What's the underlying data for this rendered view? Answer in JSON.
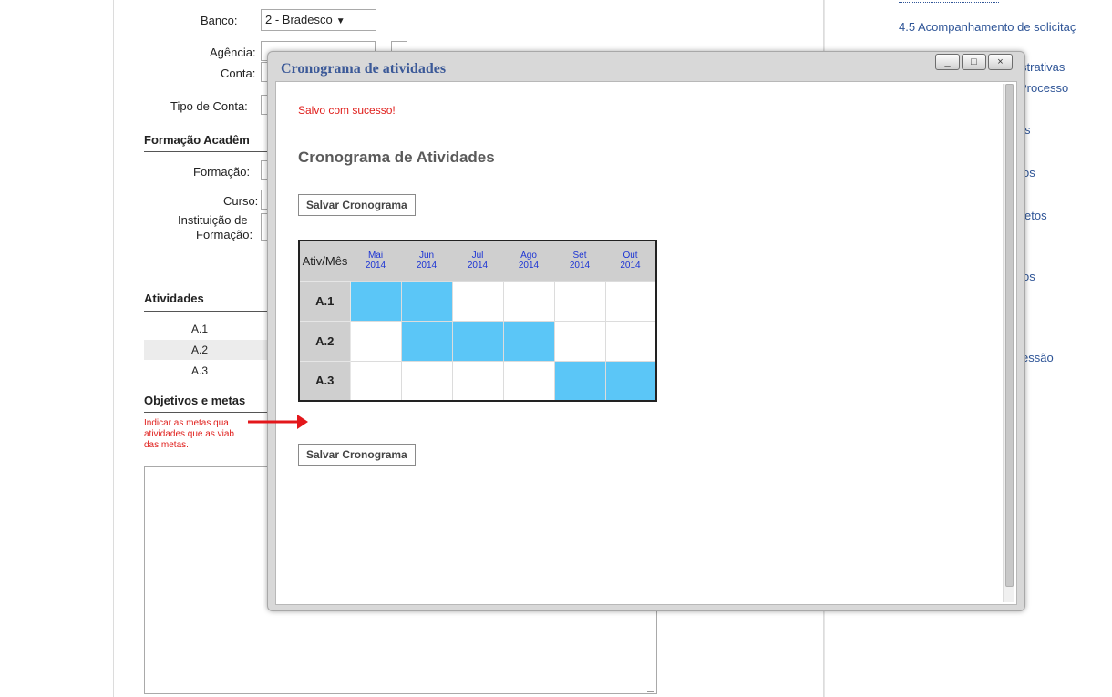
{
  "background": {
    "bank": {
      "label": "Banco:",
      "value": "2 - Bradesco"
    },
    "agency_label": "Agência:",
    "account_label": "Conta:",
    "account_type_label": "Tipo de Conta:",
    "academic_section": "Formação Acadêm",
    "formation_label": "Formação:",
    "course_label": "Curso:",
    "institution_label_1": "Instituição de",
    "institution_label_2": "Formação:",
    "activities_section": "Atividades",
    "activities": [
      "A.1",
      "A.2",
      "A.3"
    ],
    "objectives_section": "Objetivos e metas",
    "objectives_note_lines": [
      "Indicar as metas qua",
      "atividades que as viab",
      "das metas."
    ]
  },
  "right_sidebar": {
    "links": [
      {
        "text": "4.5 Acompanhamento de solicitaç"
      },
      {
        "text": "strativas"
      },
      {
        "text": "Processo"
      },
      {
        "text": "s"
      },
      {
        "text": "os"
      },
      {
        "text": "etos"
      },
      {
        "text": "os"
      },
      {
        "text": "essão"
      }
    ]
  },
  "modal": {
    "title": "Cronograma de atividades",
    "controls": {
      "minimize": "_",
      "maximize": "□",
      "close": "×"
    },
    "success_message": "Salvo com sucesso!",
    "heading": "Cronograma de Atividades",
    "save_button_top": "Salvar Cronograma",
    "save_button_bottom": "Salvar Cronograma",
    "schedule": {
      "corner_label": "Ativ/Mês",
      "months": [
        {
          "name": "Mai",
          "year": "2014"
        },
        {
          "name": "Jun",
          "year": "2014"
        },
        {
          "name": "Jul",
          "year": "2014"
        },
        {
          "name": "Ago",
          "year": "2014"
        },
        {
          "name": "Set",
          "year": "2014"
        },
        {
          "name": "Out",
          "year": "2014"
        }
      ],
      "rows": [
        {
          "activity": "A.1",
          "cells": [
            true,
            true,
            false,
            false,
            false,
            false
          ]
        },
        {
          "activity": "A.2",
          "cells": [
            false,
            true,
            true,
            true,
            false,
            false
          ]
        },
        {
          "activity": "A.3",
          "cells": [
            false,
            false,
            false,
            false,
            true,
            true
          ]
        }
      ]
    }
  },
  "colors": {
    "selected_cell": "#5bc6f7",
    "header_gray": "#cfcfcf",
    "title_blue": "#3b5998",
    "month_blue": "#1c34d4",
    "alert_red": "#e0201d",
    "annotation_arrow": "#e3171b"
  }
}
